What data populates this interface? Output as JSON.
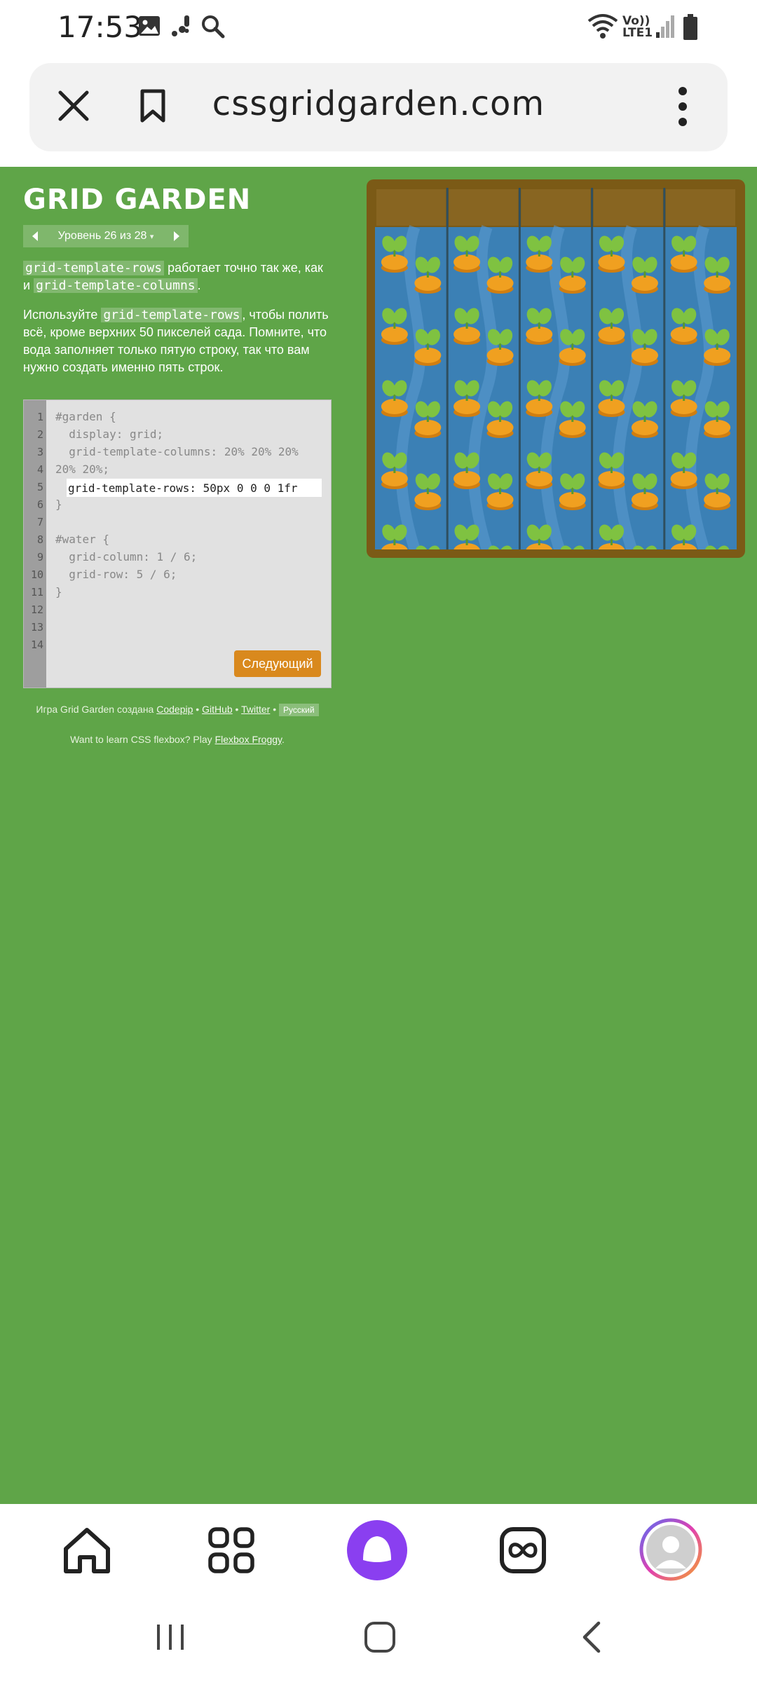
{
  "status_bar": {
    "time": "17:53",
    "network_top": "Vo))",
    "network_bottom": "LTE1"
  },
  "browser": {
    "url": "cssgridgarden.com"
  },
  "game": {
    "title": "GRID GARDEN",
    "level_label": "Уровень 26 из 28",
    "level_dropdown_glyph": "▾",
    "instr1": {
      "code1": "grid-template-rows",
      "text1": " работает точно так же, как и ",
      "code2": "grid-template-columns",
      "text2": "."
    },
    "instr2": {
      "text1": "Используйте ",
      "code1": "grid-template-rows",
      "text2": ", чтобы полить всё, кроме верхних 50 пикселей сада. Помните, что вода заполняет только пятую строку, так что вам нужно создать именно пять строк."
    },
    "editor": {
      "line_numbers": [
        "1",
        "2",
        "3",
        "4",
        "5",
        "6",
        "7",
        "8",
        "9",
        "10",
        "11",
        "12",
        "13",
        "14"
      ],
      "lines": {
        "l1": "#garden {",
        "l2": "  display: grid;",
        "l3": "  grid-template-columns: 20% 20% 20%",
        "l4": "20% 20%;",
        "l6": "}",
        "l8": "#water {",
        "l9": "  grid-column: 1 / 6;",
        "l10": "  grid-row: 5 / 6;",
        "l11": "}"
      },
      "input_value": "grid-template-rows: 50px 0 0 0 1fr",
      "next_button": "Следующий"
    },
    "credits": {
      "prefix": "Игра Grid Garden создана ",
      "codepip": "Codepip",
      "sep1": " • ",
      "github": "GitHub",
      "sep2": " • ",
      "twitter": "Twitter",
      "sep3": " • ",
      "language": "Русский"
    },
    "promo": {
      "prefix": "Want to learn CSS flexbox? Play ",
      "link": "Flexbox Froggy",
      "suffix": "."
    },
    "garden_colors": {
      "soil": "#7b5a16",
      "water": "#3b80b5",
      "carrot": "#f0a020",
      "leaf": "#7fc241"
    }
  },
  "bottom_nav": {
    "items": [
      "home",
      "apps",
      "alice",
      "services",
      "profile"
    ]
  }
}
